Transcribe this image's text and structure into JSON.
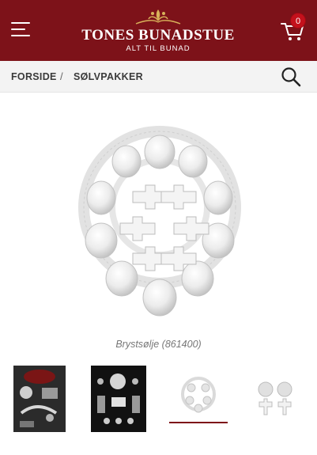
{
  "header": {
    "menu_icon": "hamburger-menu-icon",
    "logo_title": "TONES BUNADSTUE",
    "logo_subtitle": "ALT TIL BUNAD",
    "cart_icon": "shopping-cart-icon",
    "cart_count": "0",
    "brand_color": "#7d1219"
  },
  "breadcrumb": {
    "items": [
      "FORSIDE",
      "SØLVPAKKER"
    ],
    "separator": "/",
    "search_icon": "search-icon"
  },
  "product": {
    "caption": "Brystsølje (861400)"
  },
  "thumbnails": {
    "count": 4,
    "selected_index": 2,
    "accent_color": "#7d1219"
  }
}
